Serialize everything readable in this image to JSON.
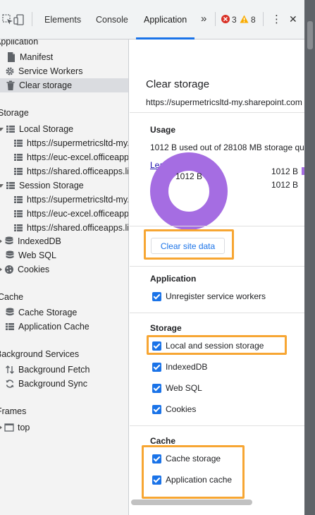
{
  "toolbar": {
    "tabs": [
      "Elements",
      "Console",
      "Application"
    ],
    "active_tab": "Application",
    "more_label": "»",
    "errors": "3",
    "warnings": "8",
    "kebab": "⋮",
    "close": "✕"
  },
  "sidebar": {
    "application_header": "Application",
    "application_items": [
      "Manifest",
      "Service Workers",
      "Clear storage"
    ],
    "selected": "Clear storage",
    "storage_header": "Storage",
    "local_storage": "Local Storage",
    "local_storage_items": [
      "https://supermetricsltd-my.",
      "https://euc-excel.officeapps",
      "https://shared.officeapps.li"
    ],
    "session_storage": "Session Storage",
    "session_storage_items": [
      "https://supermetricsltd-my.",
      "https://euc-excel.officeapp",
      "https://shared.officeapps.li"
    ],
    "other_storage": [
      "IndexedDB",
      "Web SQL",
      "Cookies"
    ],
    "cache_header": "Cache",
    "cache_items": [
      "Cache Storage",
      "Application Cache"
    ],
    "bg_header": "Background Services",
    "bg_items": [
      "Background Fetch",
      "Background Sync"
    ],
    "frames_header": "Frames",
    "frames_items": [
      "top"
    ]
  },
  "main": {
    "title": "Clear storage",
    "origin": "https://supermetricsltd-my.sharepoint.com",
    "usage_title": "Usage",
    "usage_text": "1012 B used out of 28108 MB storage qu",
    "learn_more": "Learn more",
    "donut_label": "1012 B",
    "legend_values": [
      "1012 B",
      "1012 B"
    ],
    "clear_button": "Clear site data",
    "application_title": "Application",
    "application_checks": [
      "Unregister service workers"
    ],
    "storage_title": "Storage",
    "storage_checks": [
      "Local and session storage",
      "IndexedDB",
      "Web SQL",
      "Cookies"
    ],
    "cache_title": "Cache",
    "cache_checks": [
      "Cache storage",
      "Application cache"
    ]
  },
  "colors": {
    "accent": "#1a73e8",
    "donut": "#a56de2",
    "highlight": "#f7a633",
    "error": "#d93025",
    "warning": "#f9ab00"
  }
}
